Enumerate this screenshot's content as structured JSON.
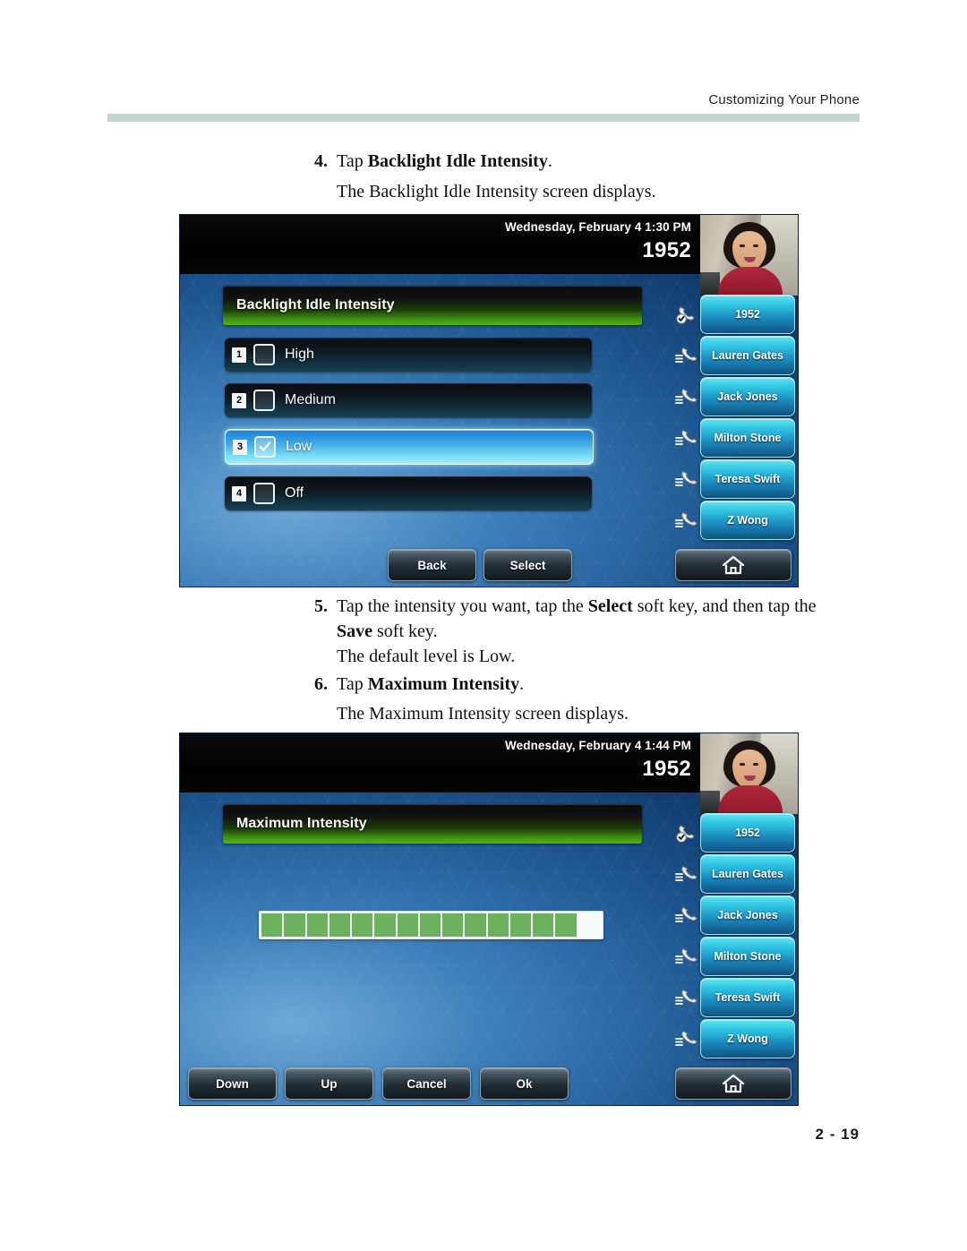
{
  "header": {
    "running_head": "Customizing Your Phone"
  },
  "footer": {
    "page_number": "2 - 19"
  },
  "colors": {
    "header_rule": "#C3D4CE",
    "progress_fill": "#6CB25E",
    "title_banner_green": "#4FB417",
    "linekey_blue": "#2EC3E2",
    "selected_row_blue": "#3EA6E6"
  },
  "steps": [
    {
      "number": "4.",
      "text_pre": "Tap ",
      "text_bold": "Backlight Idle Intensity",
      "text_post": ".",
      "note": "The Backlight Idle Intensity screen displays."
    },
    {
      "number": "5.",
      "line1_pre": "Tap the intensity you want, tap the ",
      "line1_bold": "Select",
      "line1_post": " soft key, and then tap the",
      "line2_bold": "Save",
      "line2_post": " soft key.",
      "note": "The default level is Low."
    },
    {
      "number": "6.",
      "text_pre": "Tap ",
      "text_bold": "Maximum Intensity",
      "text_post": ".",
      "note": "The Maximum Intensity screen displays."
    }
  ],
  "screen1": {
    "status": {
      "datetime": "Wednesday, February 4  1:30 PM",
      "extension": "1952"
    },
    "title": "Backlight Idle Intensity",
    "menu_items": [
      {
        "index": "1",
        "label": "High",
        "checked": false
      },
      {
        "index": "2",
        "label": "Medium",
        "checked": false
      },
      {
        "index": "3",
        "label": "Low",
        "checked": true
      },
      {
        "index": "4",
        "label": "Off",
        "checked": false
      }
    ],
    "line_keys": [
      {
        "label": "1952",
        "icon": "handset-registered-icon"
      },
      {
        "label": "Lauren Gates",
        "icon": "handset-speeddial-icon"
      },
      {
        "label": "Jack Jones",
        "icon": "handset-speeddial-icon"
      },
      {
        "label": "Milton Stone",
        "icon": "handset-speeddial-icon"
      },
      {
        "label": "Teresa Swift",
        "icon": "handset-speeddial-icon"
      },
      {
        "label": "Z Wong",
        "icon": "handset-speeddial-icon"
      }
    ],
    "soft_keys": [
      {
        "label": "Back",
        "icon": null
      },
      {
        "label": "Select",
        "icon": null
      },
      {
        "label": "",
        "icon": "home-icon"
      }
    ]
  },
  "screen2": {
    "status": {
      "datetime": "Wednesday, February 4  1:44 PM",
      "extension": "1952"
    },
    "title": "Maximum Intensity",
    "progress": {
      "total_segments": 15,
      "filled_segments": 14
    },
    "line_keys": [
      {
        "label": "1952",
        "icon": "handset-registered-icon"
      },
      {
        "label": "Lauren Gates",
        "icon": "handset-speeddial-icon"
      },
      {
        "label": "Jack Jones",
        "icon": "handset-speeddial-icon"
      },
      {
        "label": "Milton Stone",
        "icon": "handset-speeddial-icon"
      },
      {
        "label": "Teresa Swift",
        "icon": "handset-speeddial-icon"
      },
      {
        "label": "Z Wong",
        "icon": "handset-speeddial-icon"
      }
    ],
    "soft_keys": [
      {
        "label": "Down",
        "icon": null
      },
      {
        "label": "Up",
        "icon": null
      },
      {
        "label": "Cancel",
        "icon": null
      },
      {
        "label": "Ok",
        "icon": null
      },
      {
        "label": "",
        "icon": "home-icon"
      }
    ]
  }
}
